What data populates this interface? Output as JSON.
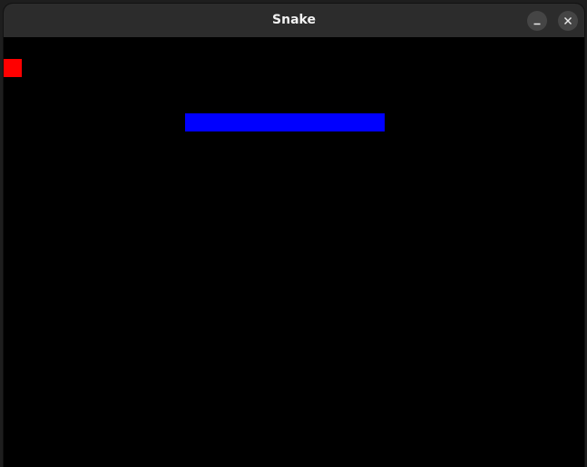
{
  "window": {
    "title": "Snake"
  },
  "titlebar_buttons": [
    {
      "name": "minimize-button",
      "icon": "minimize-icon"
    },
    {
      "name": "close-button",
      "icon": "close-icon"
    }
  ],
  "game": {
    "grid_cell_units": 20,
    "colors": {
      "background": "#000000",
      "snake": "#0000ff",
      "food": "#ff0000"
    },
    "food": {
      "col": 0,
      "row": 2
    },
    "snake": [
      {
        "col": 10,
        "row": 5
      },
      {
        "col": 11,
        "row": 5
      },
      {
        "col": 12,
        "row": 5
      },
      {
        "col": 13,
        "row": 5
      },
      {
        "col": 14,
        "row": 5
      },
      {
        "col": 15,
        "row": 5
      },
      {
        "col": 16,
        "row": 5
      },
      {
        "col": 17,
        "row": 5
      },
      {
        "col": 18,
        "row": 5
      },
      {
        "col": 19,
        "row": 5
      },
      {
        "col": 20,
        "row": 5
      }
    ]
  }
}
